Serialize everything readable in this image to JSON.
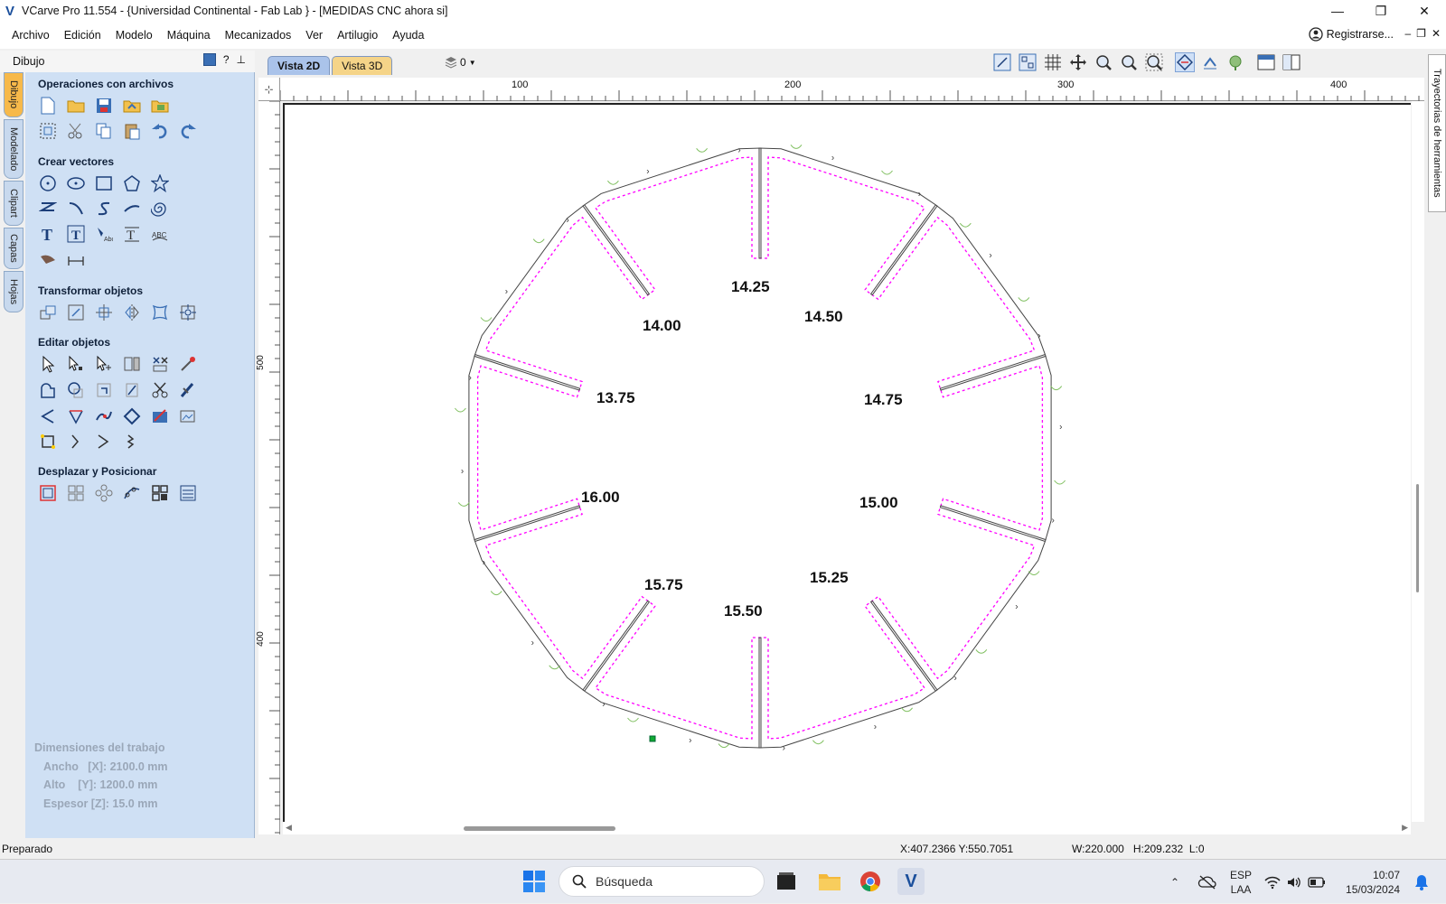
{
  "window": {
    "title": "VCarve Pro 11.554 - {Universidad Continental - Fab Lab } - [MEDIDAS CNC ahora si]"
  },
  "menu": {
    "items": [
      "Archivo",
      "Edición",
      "Modelo",
      "Máquina",
      "Mecanizados",
      "Ver",
      "Artilugio",
      "Ayuda"
    ],
    "register_label": "Registrarse..."
  },
  "dock": {
    "title": "Dibujo",
    "help_label": "?"
  },
  "left_tabs": [
    "Dibujo",
    "Modelado",
    "Clipart",
    "Capas",
    "Hojas"
  ],
  "sections": {
    "files": "Operaciones con archivos",
    "create": "Crear vectores",
    "transform": "Transformar objetos",
    "edit": "Editar objetos",
    "move": "Desplazar y Posicionar"
  },
  "job_dimensions": {
    "heading": "Dimensiones del trabajo",
    "width": "Ancho   [X]: 2100.0 mm",
    "height": "Alto    [Y]: 1200.0 mm",
    "thickness": "Espesor [Z]: 15.0 mm"
  },
  "view_tabs": [
    "Vista 2D",
    "Vista 3D"
  ],
  "layer_selector": {
    "value": "0"
  },
  "right_panel": {
    "label": "Trayectorias de herramientas"
  },
  "ruler": {
    "top_labels": [
      "100",
      "200",
      "300",
      "400"
    ],
    "left_labels": [
      "500",
      "400"
    ]
  },
  "drawing": {
    "slot_labels": [
      "14.25",
      "14.50",
      "14.75",
      "15.00",
      "15.25",
      "15.50",
      "15.75",
      "16.00",
      "13.75",
      "14.00"
    ],
    "colors": {
      "vector": "#ff00ff",
      "toolpath": "#444444",
      "leadin": "#7fbf5f"
    }
  },
  "status": {
    "ready": "Preparado",
    "cursor": "X:407.2366 Y:550.7051",
    "selection": "W:220.000   H:209.232  L:0"
  },
  "taskbar": {
    "search_placeholder": "Búsqueda",
    "lang_top": "ESP",
    "lang_bottom": "LAA",
    "time": "10:07",
    "date": "15/03/2024"
  }
}
